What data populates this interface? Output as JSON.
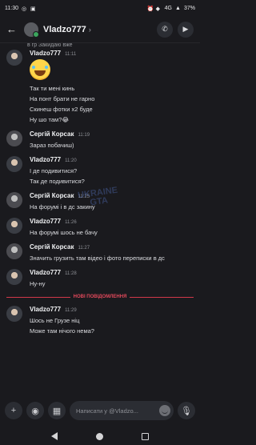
{
  "status": {
    "time": "11:30",
    "network": "4G",
    "battery": "37%"
  },
  "header": {
    "title": "Vladzo777"
  },
  "top_fragment": "в гр Закидаю вже",
  "messages": [
    {
      "author": "Vladzo777",
      "time": "11:11",
      "avatar": "v",
      "has_emoji": true,
      "lines": [
        "Так ти мені кинь",
        "На понт брати не гарно",
        "Скинеш фотки х2 буде",
        "Ну шо там?😂"
      ]
    },
    {
      "author": "Сергій Корсак",
      "time": "11:19",
      "avatar": "s",
      "lines": [
        "Зараз побачиш)"
      ]
    },
    {
      "author": "Vladzo777",
      "time": "11:20",
      "avatar": "v",
      "lines": [
        "І де подивитися?",
        "Так де подивитися?"
      ]
    },
    {
      "author": "Сергій Корсак",
      "time": "11:25",
      "avatar": "s",
      "lines": [
        "На форумі і в дс закину"
      ]
    },
    {
      "author": "Vladzo777",
      "time": "11:26",
      "avatar": "v",
      "lines": [
        "На форумі шось не бачу"
      ]
    },
    {
      "author": "Сергій Корсак",
      "time": "11:27",
      "avatar": "s",
      "lines": [
        "Значить грузить там відео і фото переписки в дс"
      ]
    },
    {
      "author": "Vladzo777",
      "time": "11:28",
      "avatar": "v",
      "lines": [
        "Ну-ну"
      ]
    }
  ],
  "divider_label": "НОВІ ПОВІДОМЛЕННЯ",
  "new_messages": [
    {
      "author": "Vladzo777",
      "time": "11:29",
      "avatar": "v",
      "lines": [
        "Шось не Грузе ніц",
        "Може там нічого нема?"
      ]
    }
  ],
  "watermark": "UKRAINE GTA",
  "composer": {
    "placeholder": "Написати у @Vladzo..."
  },
  "icons": [
    "back-arrow-icon",
    "phone-icon",
    "video-icon",
    "plus-icon",
    "gamepad-icon",
    "gift-icon",
    "emoji-icon",
    "microphone-icon"
  ]
}
